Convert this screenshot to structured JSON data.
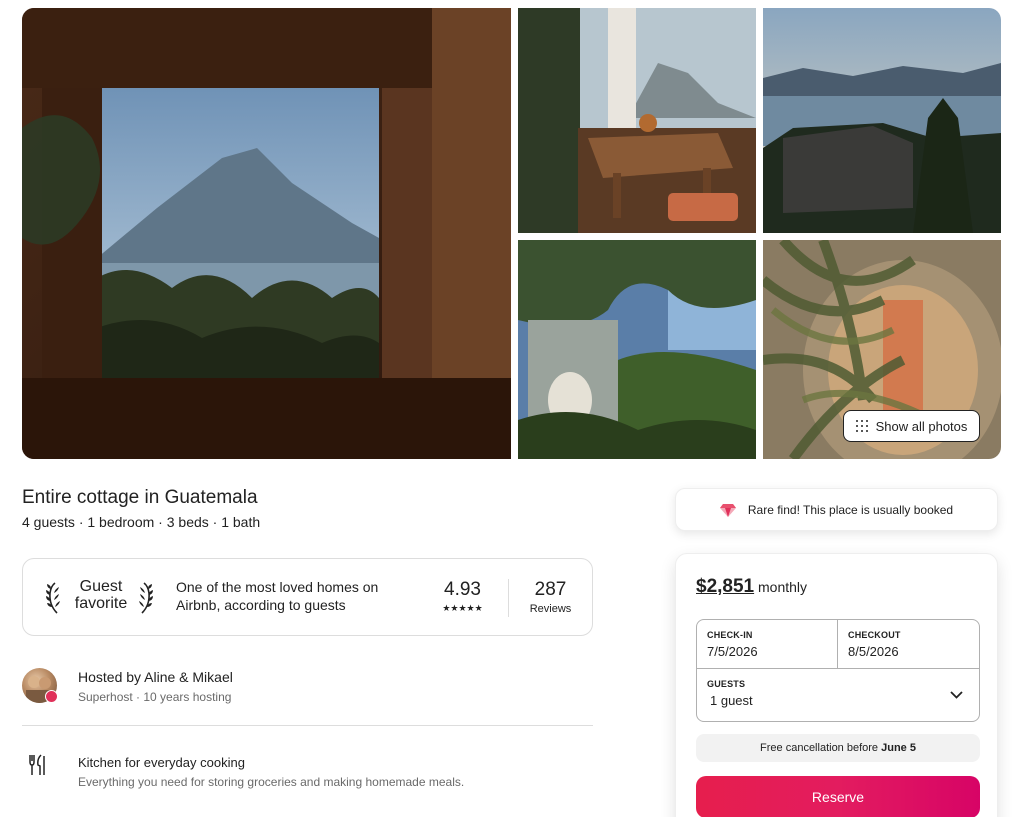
{
  "gallery": {
    "show_all_label": "Show all photos"
  },
  "listing": {
    "title": "Entire cottage in Guatemala",
    "details": "4 guests · 1 bedroom · 3 beds · 1 bath"
  },
  "guest_favorite": {
    "label": "Guest favorite",
    "description": "One of the most loved homes on Airbnb, according to guests",
    "rating": "4.93",
    "stars": "★★★★★",
    "reviews_count": "287",
    "reviews_label": "Reviews"
  },
  "host": {
    "name": "Hosted by Aline & Mikael",
    "meta": "Superhost · 10 years hosting"
  },
  "amenities": [
    {
      "title": "Kitchen for everyday cooking",
      "description": "Everything you need for storing groceries and making homemade meals.",
      "icon": "utensils-icon"
    }
  ],
  "rare_find": {
    "text": "Rare find! This place is usually booked",
    "icon": "gem-icon"
  },
  "booking": {
    "price": "$2,851",
    "period": "monthly",
    "checkin_label": "CHECK-IN",
    "checkin_value": "7/5/2026",
    "checkout_label": "CHECKOUT",
    "checkout_value": "8/5/2026",
    "guests_label": "GUESTS",
    "guests_value": "1 guest",
    "cancellation_prefix": "Free cancellation before",
    "cancellation_date": "June 5",
    "reserve_label": "Reserve"
  },
  "colors": {
    "brand": "#e31c5f",
    "text": "#222222",
    "muted": "#6a6a6a",
    "border": "#dddddd"
  }
}
